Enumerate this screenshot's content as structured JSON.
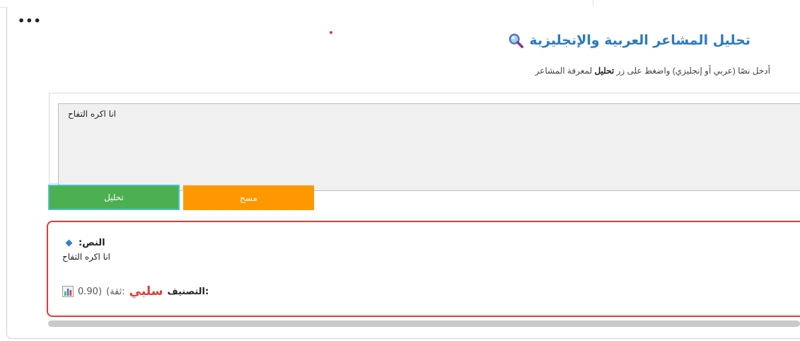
{
  "menu": {
    "dots": "•••"
  },
  "header": {
    "title": "تحليل المشاعر العربية والإنجليزية",
    "subtitle_before": "أدخل نصًا (عربي أو إنجليزي) واضغط على زر ",
    "subtitle_bold": "تحليل",
    "subtitle_after": " لمعرفة المشاعر"
  },
  "input": {
    "value": "انا اكره التفاح"
  },
  "buttons": {
    "analyze": "تحليل",
    "clear": "مسح"
  },
  "result": {
    "text_label": ":النص",
    "text_value": "انا اكره التفاح",
    "class_label": "التصنيف:",
    "class_value": "سلبي",
    "confidence_prefix": "(ثقة:",
    "confidence_value": "0.90)"
  },
  "colors": {
    "title": "#2b7bc0",
    "analyze_button": "#4caf50",
    "clear_button": "#ff9800",
    "negative": "#e53935"
  },
  "icons": {
    "title_icon": "magnifier-icon",
    "label_icon": "diamond-icon",
    "class_icon": "bar-chart-icon"
  }
}
